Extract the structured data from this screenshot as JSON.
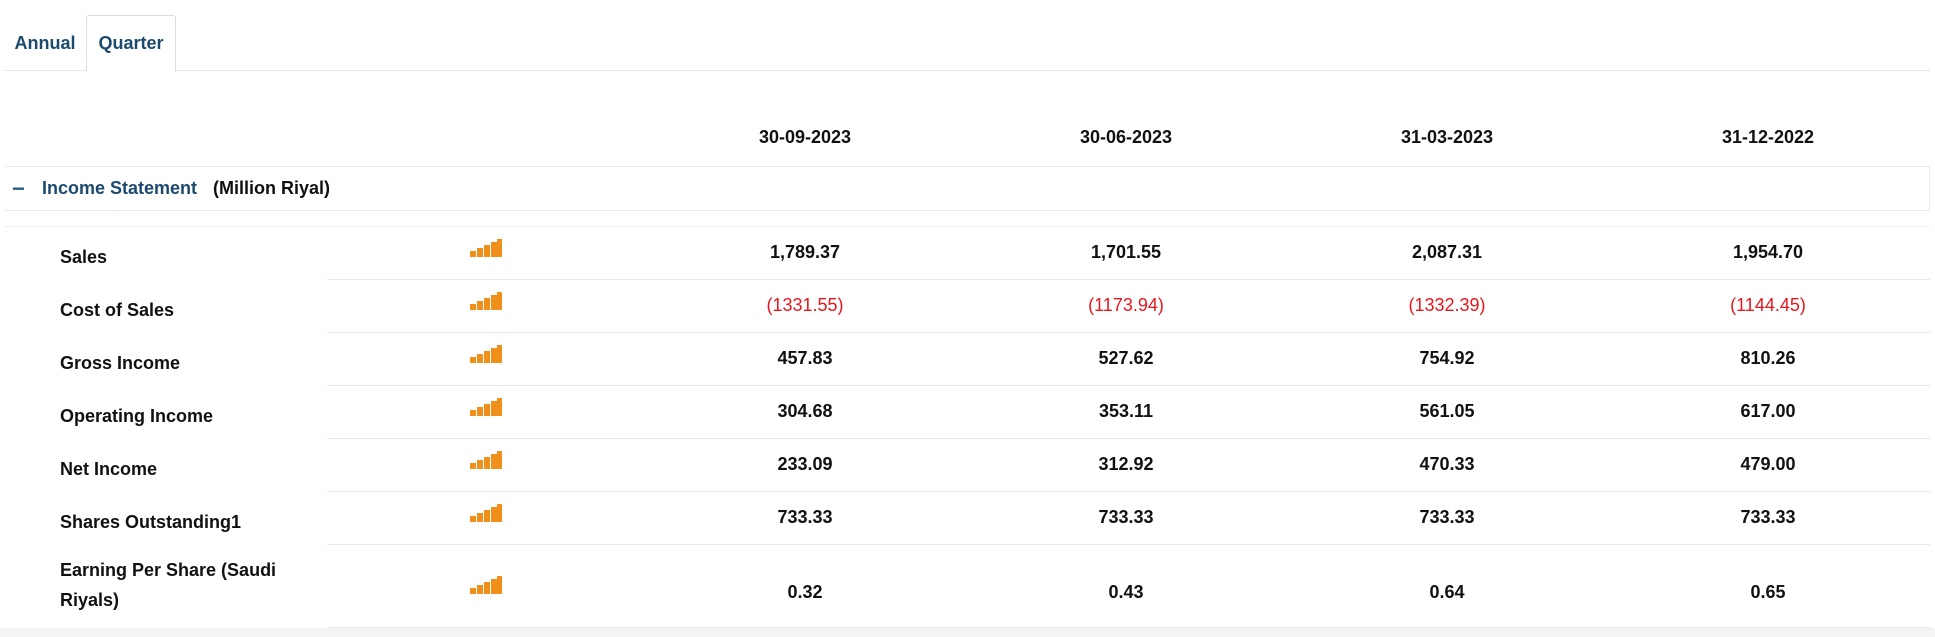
{
  "tabs": {
    "annual": "Annual",
    "quarter": "Quarter"
  },
  "dates": [
    "30-09-2023",
    "30-06-2023",
    "31-03-2023",
    "31-12-2022"
  ],
  "section": {
    "collapse_symbol": "−",
    "title": "Income Statement",
    "unit": "(Million Riyal)"
  },
  "accent_color": "#f0901a",
  "negative_color": "#e8161c",
  "rows": [
    {
      "label": "Sales",
      "values": [
        "1,789.37",
        "1,701.55",
        "2,087.31",
        "1,954.70"
      ],
      "negative": false
    },
    {
      "label": "Cost of Sales",
      "values": [
        "(1331.55)",
        "(1173.94)",
        "(1332.39)",
        "(1144.45)"
      ],
      "negative": true
    },
    {
      "label": "Gross Income",
      "values": [
        "457.83",
        "527.62",
        "754.92",
        "810.26"
      ],
      "negative": false
    },
    {
      "label": "Operating Income",
      "values": [
        "304.68",
        "353.11",
        "561.05",
        "617.00"
      ],
      "negative": false
    },
    {
      "label": "Net Income",
      "values": [
        "233.09",
        "312.92",
        "470.33",
        "479.00"
      ],
      "negative": false
    },
    {
      "label": "Shares Outstanding1",
      "values": [
        "733.33",
        "733.33",
        "733.33",
        "733.33"
      ],
      "negative": false
    },
    {
      "label": "Earning Per Share (Saudi Riyals)",
      "values": [
        "0.32",
        "0.43",
        "0.64",
        "0.65"
      ],
      "negative": false
    }
  ],
  "row_icon": "bar-chart-icon"
}
